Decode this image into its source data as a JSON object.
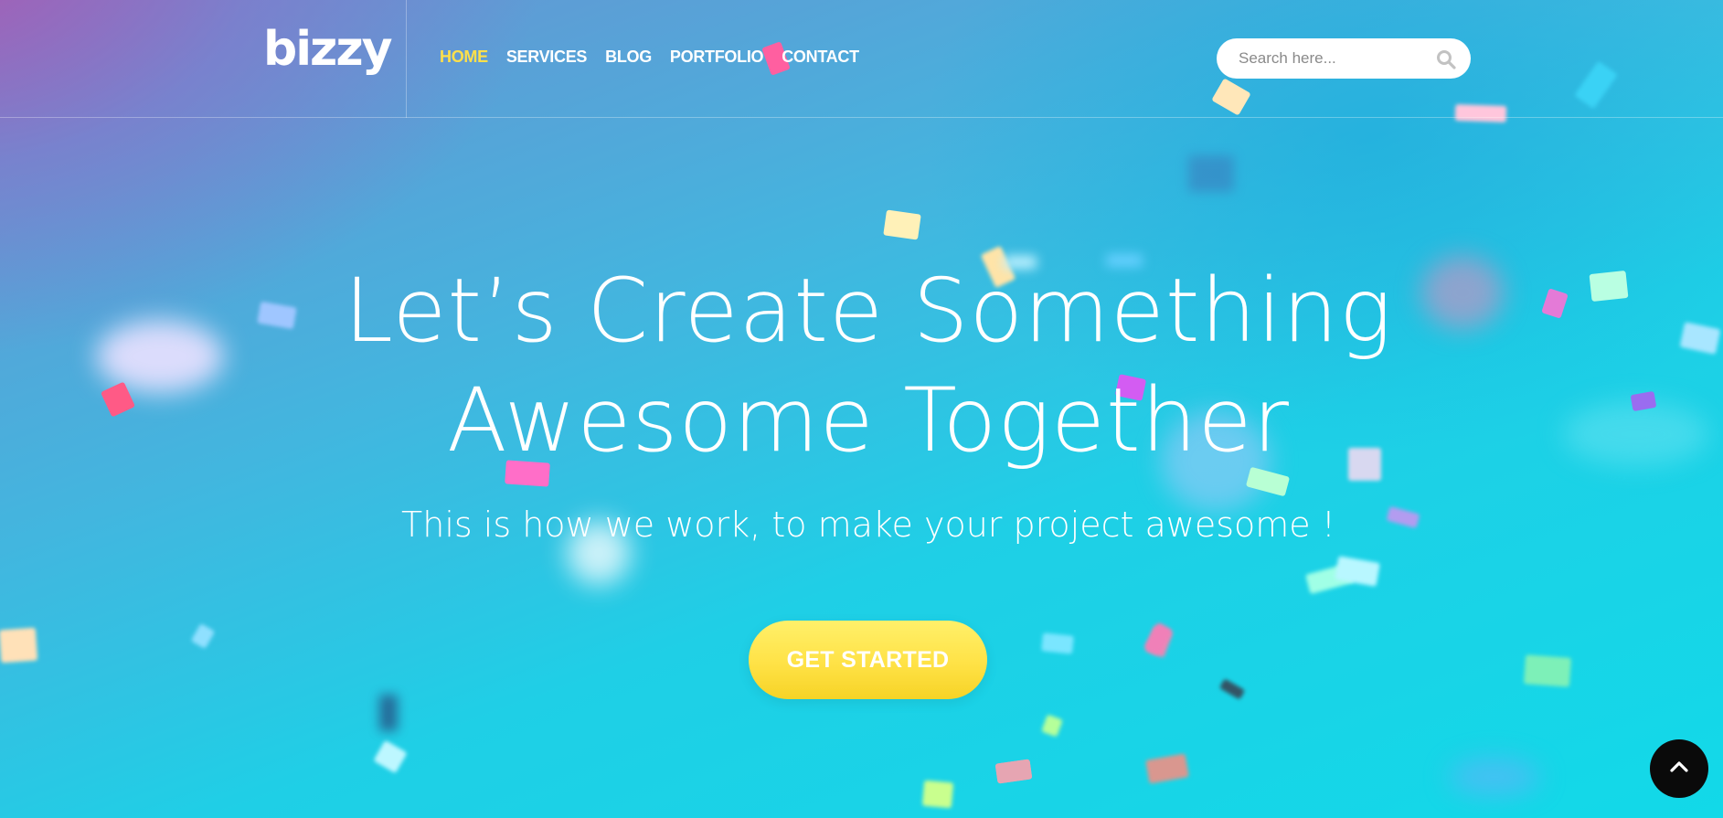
{
  "header": {
    "logo": "bizzy",
    "nav": [
      {
        "label": "HOME",
        "active": true
      },
      {
        "label": "SERVICES",
        "active": false
      },
      {
        "label": "BLOG",
        "active": false
      },
      {
        "label": "PORTFOLIO",
        "active": false
      },
      {
        "label": "CONTACT",
        "active": false
      }
    ],
    "search": {
      "placeholder": "Search here...",
      "value": "",
      "icon": "search-icon"
    }
  },
  "hero": {
    "headline_line1": "Let’s Create Something",
    "headline_line2": "Awesome Together",
    "subheadline": "This is how we work, to make your project awesome !",
    "cta_label": "GET STARTED"
  },
  "scroll_top": {
    "icon": "chevron-up-icon"
  },
  "colors": {
    "accent_yellow": "#ffe04a",
    "nav_text": "#ffffff",
    "scroll_button": "#0a0a0a"
  }
}
